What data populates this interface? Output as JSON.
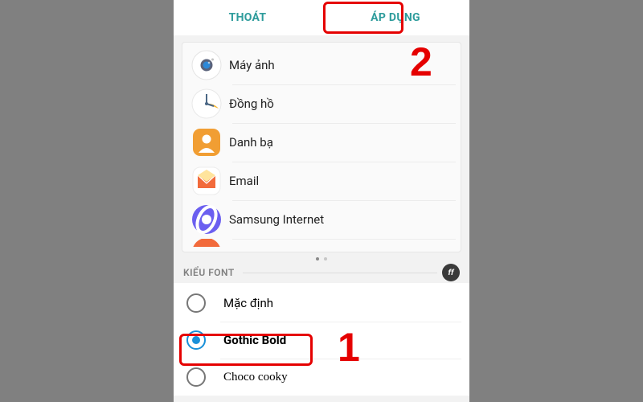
{
  "header": {
    "exit_label": "THOÁT",
    "apply_label": "ÁP DỤNG"
  },
  "apps": [
    {
      "label": "Máy ảnh"
    },
    {
      "label": "Đồng hồ"
    },
    {
      "label": "Danh bạ"
    },
    {
      "label": "Email"
    },
    {
      "label": "Samsung Internet"
    }
  ],
  "font_section": {
    "title": "KIỂU FONT",
    "badge": "ff"
  },
  "fonts": [
    {
      "label": "Mặc định",
      "selected": false
    },
    {
      "label": "Gothic Bold",
      "selected": true
    },
    {
      "label": "Choco cooky",
      "selected": false
    }
  ],
  "callouts": {
    "one": "1",
    "two": "2"
  }
}
